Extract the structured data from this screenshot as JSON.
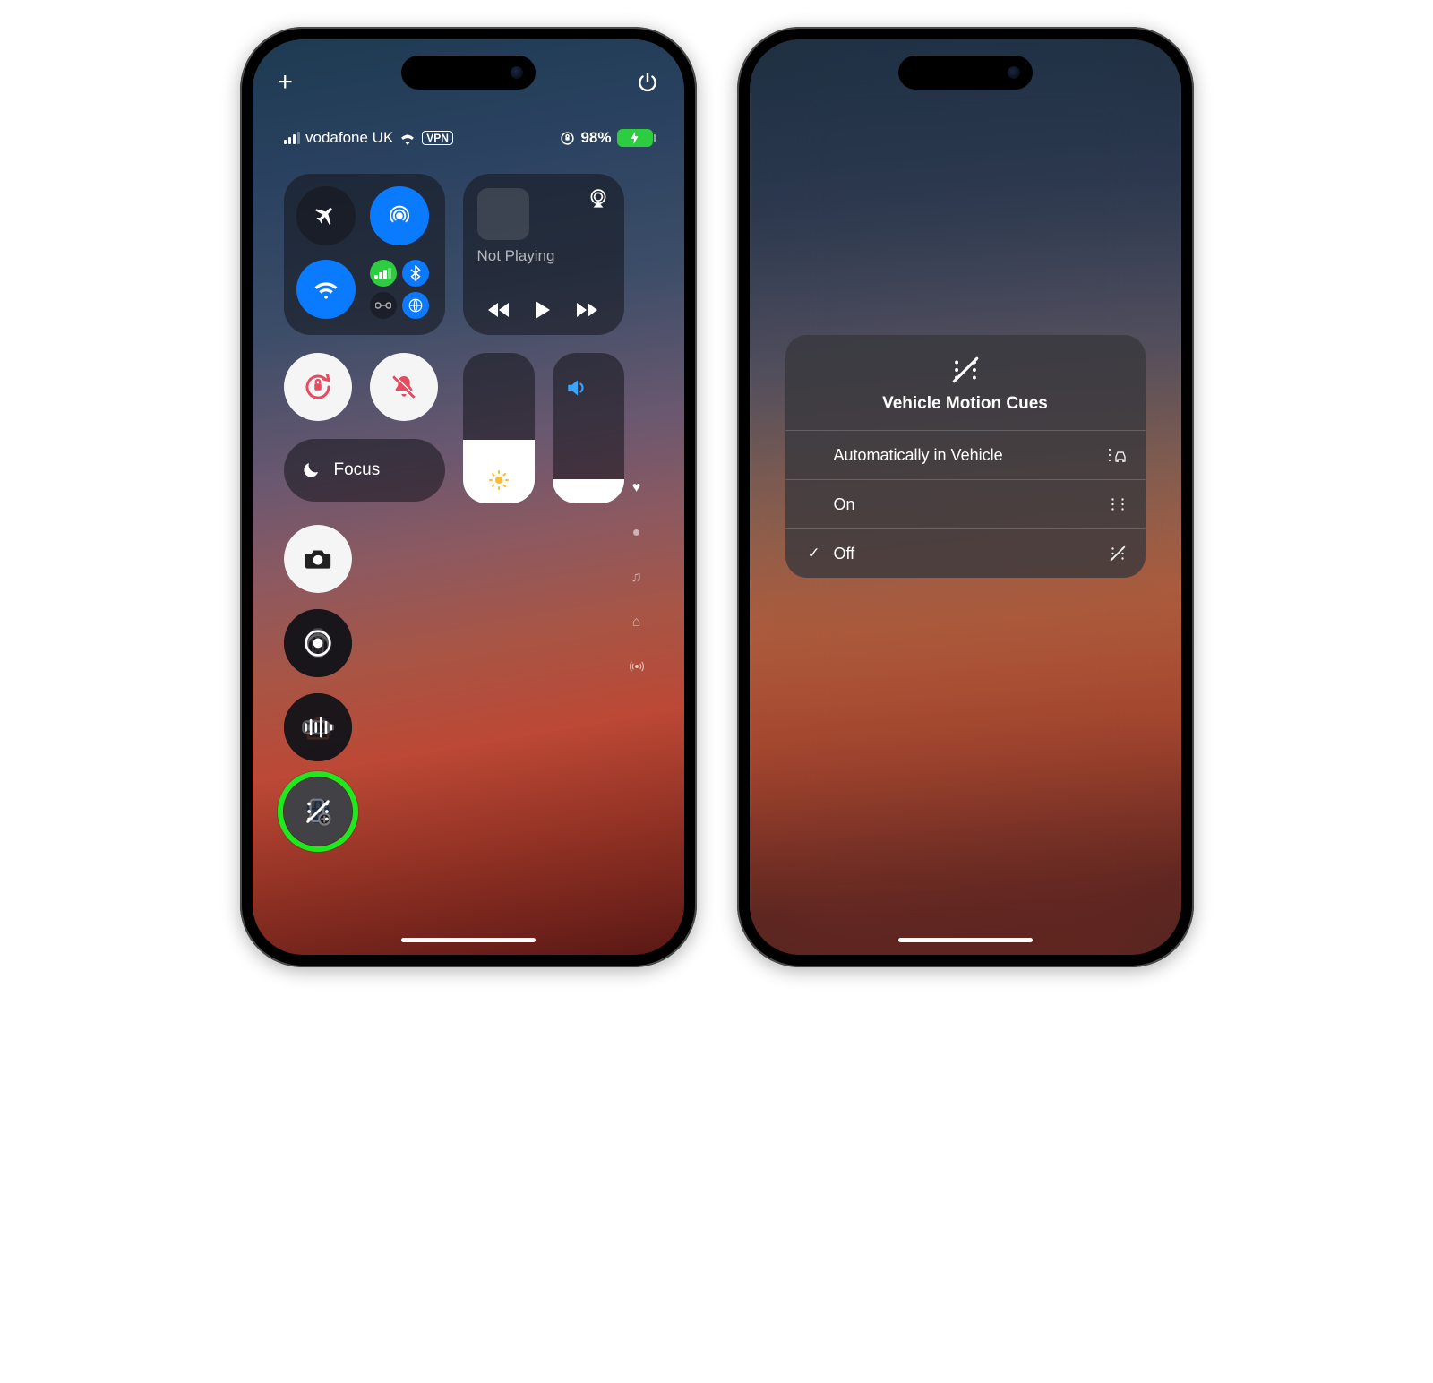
{
  "left": {
    "status": {
      "carrier": "vodafone UK",
      "vpn": "VPN",
      "battery_pct": "98%"
    },
    "media": {
      "label": "Not Playing"
    },
    "focus": {
      "label": "Focus"
    }
  },
  "right": {
    "popup": {
      "title": "Vehicle Motion Cues",
      "options": [
        {
          "label": "Automatically in Vehicle",
          "selected": false
        },
        {
          "label": "On",
          "selected": false
        },
        {
          "label": "Off",
          "selected": true
        }
      ]
    }
  }
}
